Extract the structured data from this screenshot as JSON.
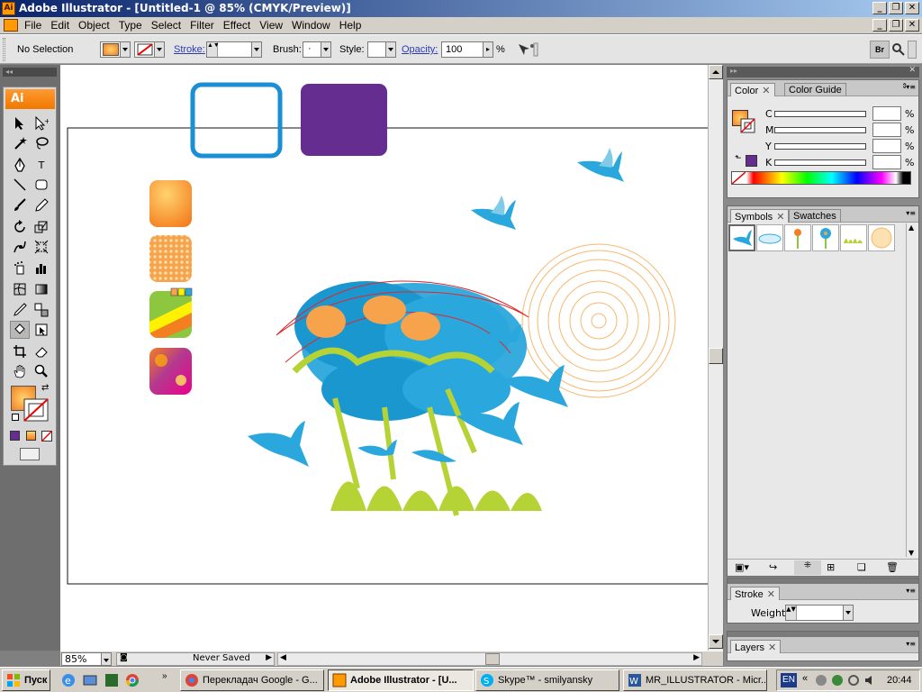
{
  "window": {
    "title": "Adobe Illustrator - [Untitled-1 @ 85% (CMYK/Preview)]",
    "app_logo": "Ai",
    "controls": [
      "minimize",
      "restore",
      "close"
    ]
  },
  "menu": [
    "File",
    "Edit",
    "Object",
    "Type",
    "Select",
    "Filter",
    "Effect",
    "View",
    "Window",
    "Help"
  ],
  "control_bar": {
    "selection": "No Selection",
    "stroke_label": "Stroke:",
    "brush_label": "Brush:",
    "brush_value": "·",
    "style_label": "Style:",
    "opacity_label": "Opacity:",
    "opacity_value": "100",
    "opacity_unit": "%",
    "bridge_label": "Br"
  },
  "toolbox": {
    "logo": "Ai",
    "type_tool": "T",
    "fill_color": "#f58a34",
    "stroke_color": "none"
  },
  "status": {
    "zoom": "85%",
    "save_state": "Never Saved"
  },
  "color_panel": {
    "tabs": [
      "Color",
      "Color Guide"
    ],
    "channels": [
      {
        "name": "C",
        "unit": "%"
      },
      {
        "name": "M",
        "unit": "%"
      },
      {
        "name": "Y",
        "unit": "%"
      },
      {
        "name": "K",
        "unit": "%"
      }
    ]
  },
  "symbols_panel": {
    "tabs": [
      "Symbols",
      "Swatches"
    ],
    "symbols": [
      "bird-symbol",
      "cloud-symbol",
      "flower-symbol",
      "blue-flower-symbol",
      "grass-symbol",
      "dandelion-symbol"
    ]
  },
  "stroke_panel": {
    "tab": "Stroke",
    "weight_label": "Weight:"
  },
  "layers_panel": {
    "tab": "Layers"
  },
  "colors": {
    "accent_orange": "#f58a34",
    "swatch_purple": "#662d91",
    "rect_blue": "#1b8fd6",
    "bird_blue": "#2aa7dc",
    "grass_green": "#b5d334"
  },
  "taskbar": {
    "start": "Пуск",
    "items": [
      {
        "label": "Перекладач Google - G...",
        "active": false
      },
      {
        "label": "Adobe Illustrator - [U...",
        "active": true
      },
      {
        "label": "Skype™ - smilyansky",
        "active": false
      },
      {
        "label": "MR_ILLUSTRATOR - Micr...",
        "active": false
      }
    ],
    "lang": "EN",
    "clock": "20:44"
  }
}
